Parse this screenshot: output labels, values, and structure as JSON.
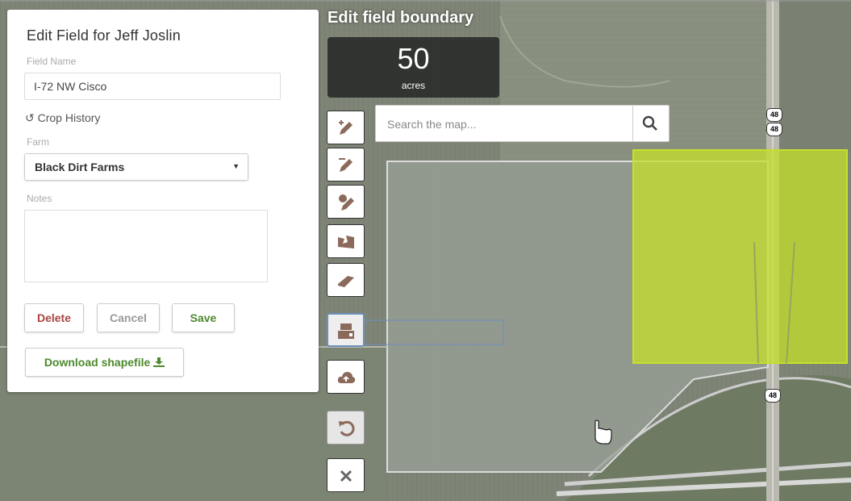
{
  "panel": {
    "title": "Edit Field for Jeff Joslin",
    "field_name_label": "Field Name",
    "field_name_value": "I-72 NW Cisco",
    "crop_history_label": "Crop History",
    "farm_label": "Farm",
    "farm_value": "Black Dirt Farms",
    "notes_label": "Notes",
    "notes_value": "",
    "delete_label": "Delete",
    "cancel_label": "Cancel",
    "save_label": "Save",
    "download_label": "Download shapefile"
  },
  "map": {
    "title": "Edit field boundary",
    "acres_value": "50",
    "acres_unit": "acres",
    "search_placeholder": "Search the map...",
    "route_shields": [
      "48",
      "48",
      "48"
    ]
  },
  "tools": [
    {
      "name": "draw-new-boundary-tool",
      "icon": "pencil-plus-icon"
    },
    {
      "name": "edit-boundary-tool",
      "icon": "pencil-icon"
    },
    {
      "name": "draw-cutout-tool",
      "icon": "pencil-cut-icon"
    },
    {
      "name": "split-boundary-tool",
      "icon": "split-map-icon"
    },
    {
      "name": "erase-tool",
      "icon": "eraser-icon"
    },
    {
      "name": "merge-boundaries-tool",
      "icon": "merge-blocks-icon",
      "active": true
    },
    {
      "name": "upload-tool",
      "icon": "cloud-upload-icon"
    },
    {
      "name": "undo-tool",
      "icon": "undo-icon",
      "disabled": true
    },
    {
      "name": "close-tool",
      "icon": "close-icon"
    }
  ],
  "colors": {
    "delete": "#a94442",
    "save": "#4c8a2c",
    "selection_fill": "#c6e02a",
    "tool_icon": "#8b6a5c"
  }
}
